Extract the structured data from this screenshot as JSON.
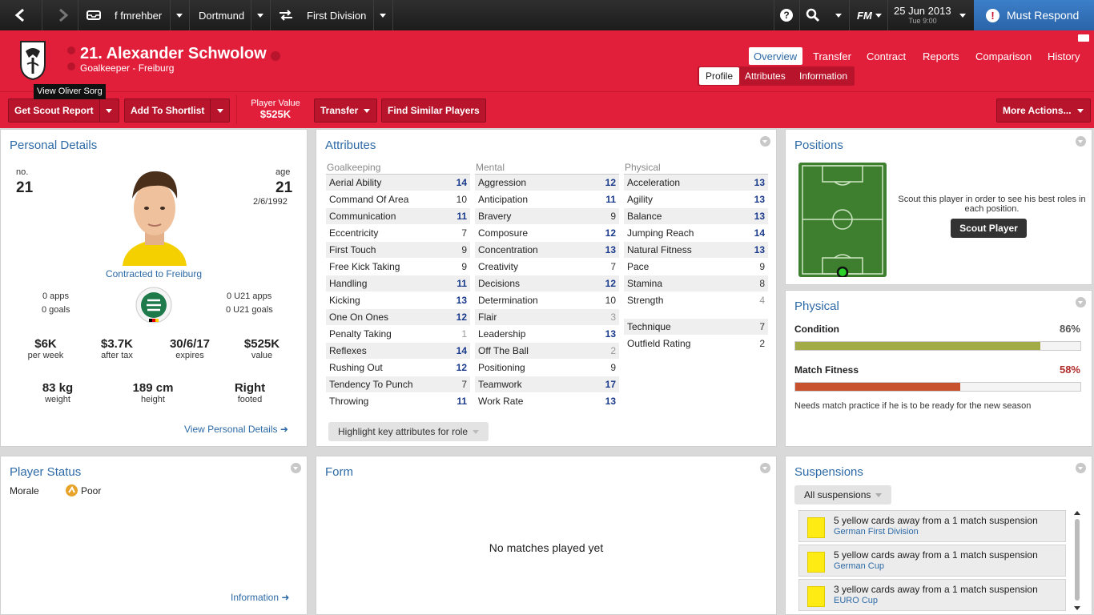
{
  "topbar": {
    "manager": "f fmrehber",
    "club": "Dortmund",
    "competition": "First Division",
    "fm_label": "FM",
    "date": "25 Jun 2013",
    "time": "Tue 9:00",
    "must_respond": "Must Respond"
  },
  "header": {
    "player_name": "21. Alexander Schwolow",
    "subtitle": "Goalkeeper - Freiburg",
    "tooltip": "View Oliver Sorg",
    "tabs": [
      "Overview",
      "Transfer",
      "Contract",
      "Reports",
      "Comparison",
      "History"
    ],
    "active_tab": "Overview",
    "subtabs": [
      "Profile",
      "Attributes",
      "Information"
    ],
    "active_subtab": "Profile",
    "accent": "#e21f3b"
  },
  "actions": {
    "scout_report": "Get Scout Report",
    "shortlist": "Add To Shortlist",
    "player_value_label": "Player Value",
    "player_value": "$525K",
    "transfer": "Transfer",
    "find_similar": "Find Similar Players",
    "more_actions": "More Actions..."
  },
  "personal": {
    "title": "Personal Details",
    "no_label": "no.",
    "number": "21",
    "age_label": "age",
    "age": "21",
    "dob": "2/6/1992",
    "contract": "Contracted to Freiburg",
    "apps": "0 apps",
    "goals": "0 goals",
    "u21_apps": "0 U21 apps",
    "u21_goals": "0 U21 goals",
    "wage": "$6K",
    "wage_label": "per week",
    "after_tax": "$3.7K",
    "after_tax_label": "after tax",
    "expires": "30/6/17",
    "expires_label": "expires",
    "value": "$525K",
    "value_label": "value",
    "weight": "83 kg",
    "weight_label": "weight",
    "height": "189 cm",
    "height_label": "height",
    "foot": "Right",
    "foot_label": "footed",
    "link": "View Personal Details"
  },
  "attributes": {
    "title": "Attributes",
    "goalkeeping_label": "Goalkeeping",
    "mental_label": "Mental",
    "physical_label": "Physical",
    "goalkeeping": [
      [
        "Aerial Ability",
        "14"
      ],
      [
        "Command Of Area",
        "10"
      ],
      [
        "Communication",
        "11"
      ],
      [
        "Eccentricity",
        "7"
      ],
      [
        "First Touch",
        "9"
      ],
      [
        "Free Kick Taking",
        "9"
      ],
      [
        "Handling",
        "11"
      ],
      [
        "Kicking",
        "13"
      ],
      [
        "One On Ones",
        "12"
      ],
      [
        "Penalty Taking",
        "1"
      ],
      [
        "Reflexes",
        "14"
      ],
      [
        "Rushing Out",
        "12"
      ],
      [
        "Tendency To Punch",
        "7"
      ],
      [
        "Throwing",
        "11"
      ]
    ],
    "mental": [
      [
        "Aggression",
        "12"
      ],
      [
        "Anticipation",
        "11"
      ],
      [
        "Bravery",
        "9"
      ],
      [
        "Composure",
        "12"
      ],
      [
        "Concentration",
        "13"
      ],
      [
        "Creativity",
        "7"
      ],
      [
        "Decisions",
        "12"
      ],
      [
        "Determination",
        "10"
      ],
      [
        "Flair",
        "3"
      ],
      [
        "Leadership",
        "13"
      ],
      [
        "Off The Ball",
        "2"
      ],
      [
        "Positioning",
        "9"
      ],
      [
        "Teamwork",
        "17"
      ],
      [
        "Work Rate",
        "13"
      ]
    ],
    "physical": [
      [
        "Acceleration",
        "13"
      ],
      [
        "Agility",
        "13"
      ],
      [
        "Balance",
        "13"
      ],
      [
        "Jumping Reach",
        "14"
      ],
      [
        "Natural Fitness",
        "13"
      ],
      [
        "Pace",
        "9"
      ],
      [
        "Stamina",
        "8"
      ],
      [
        "Strength",
        "4"
      ]
    ],
    "technique": [
      "Technique",
      "7"
    ],
    "outfield": [
      "Outfield Rating",
      "2"
    ],
    "highlight_button": "Highlight key attributes for role"
  },
  "positions": {
    "title": "Positions",
    "note": "Scout this player in order to see his best roles in each position.",
    "scout_button": "Scout Player"
  },
  "physical": {
    "title": "Physical",
    "condition_label": "Condition",
    "condition": "86%",
    "condition_value": 0.86,
    "fitness_label": "Match Fitness",
    "fitness": "58%",
    "fitness_value": 0.58,
    "note": "Needs match practice if he is to be ready for the new season"
  },
  "status": {
    "title": "Player Status",
    "morale_label": "Morale",
    "morale": "Poor",
    "link": "Information"
  },
  "form": {
    "title": "Form",
    "empty": "No matches played yet"
  },
  "suspensions": {
    "title": "Suspensions",
    "filter": "All suspensions",
    "items": [
      {
        "text": "5 yellow cards away from a 1 match suspension",
        "comp": "German First Division"
      },
      {
        "text": "5 yellow cards away from a 1 match suspension",
        "comp": "German Cup"
      },
      {
        "text": "3 yellow cards away from a 1 match suspension",
        "comp": "EURO Cup"
      }
    ]
  }
}
